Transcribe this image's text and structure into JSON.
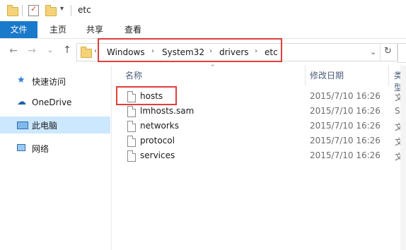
{
  "window": {
    "title": "etc"
  },
  "ribbon": {
    "tabs": [
      "文件",
      "主页",
      "共享",
      "查看"
    ]
  },
  "address": {
    "crumbs": [
      "Windows",
      "System32",
      "drivers",
      "etc"
    ]
  },
  "nav": {
    "items": [
      {
        "label": "快速访问",
        "icon": "star-icon"
      },
      {
        "label": "OneDrive",
        "icon": "cloud-icon"
      },
      {
        "label": "此电脑",
        "icon": "computer-icon"
      },
      {
        "label": "网络",
        "icon": "network-icon"
      }
    ]
  },
  "columns": {
    "name": "名称",
    "modified": "修改日期",
    "type": "类型"
  },
  "files": [
    {
      "name": "hosts",
      "date": "2015/7/10 16:26",
      "type": "文件"
    },
    {
      "name": "lmhosts.sam",
      "date": "2015/7/10 16:26",
      "type": "SAM"
    },
    {
      "name": "networks",
      "date": "2015/7/10 16:26",
      "type": "文件"
    },
    {
      "name": "protocol",
      "date": "2015/7/10 16:26",
      "type": "文件"
    },
    {
      "name": "services",
      "date": "2015/7/10 16:26",
      "type": "文件"
    }
  ],
  "colors": {
    "accent": "#1979ca",
    "highlight": "#e23e3e",
    "selected": "#cce8ff"
  }
}
